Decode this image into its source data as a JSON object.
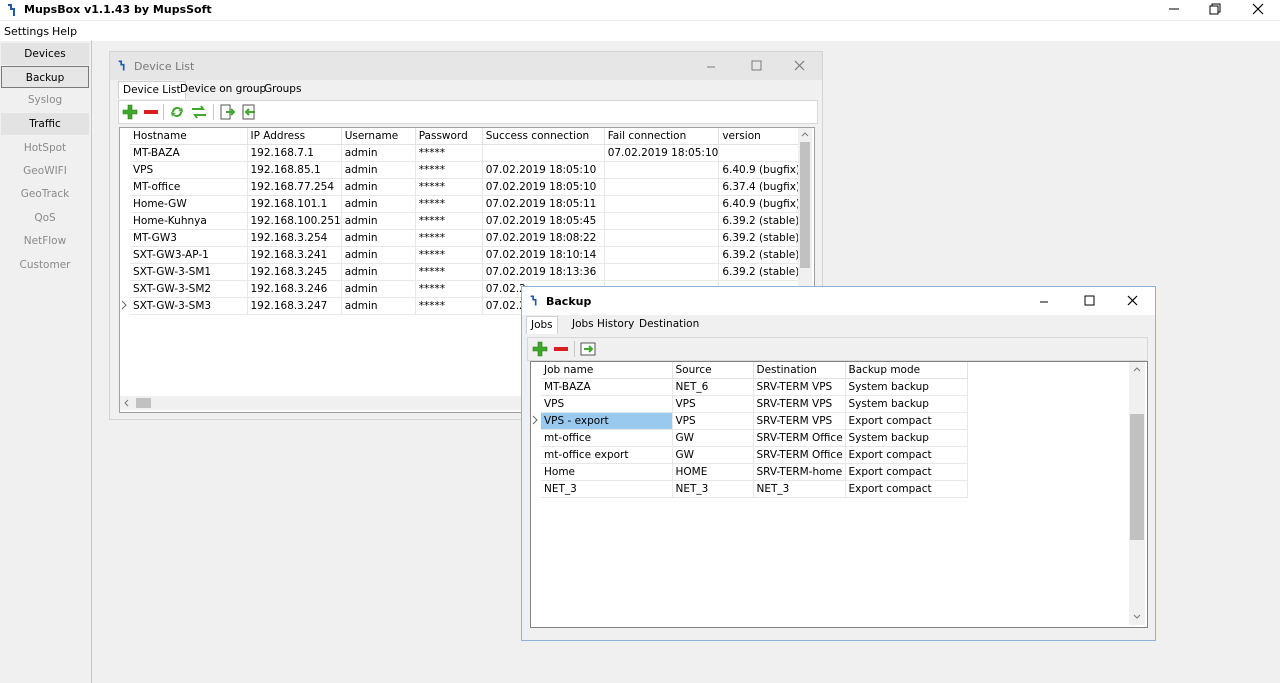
{
  "app": {
    "title": "MupsBox v1.1.43  by MupsSoft",
    "menu": [
      "Settings",
      "Help"
    ]
  },
  "nav": [
    {
      "label": "Devices",
      "state": "enabled"
    },
    {
      "label": "Backup",
      "state": "selected"
    },
    {
      "label": "Syslog",
      "state": "disabled"
    },
    {
      "label": "Traffic",
      "state": "enabled"
    },
    {
      "label": "HotSpot",
      "state": "disabled"
    },
    {
      "label": "GeoWIFI",
      "state": "disabled"
    },
    {
      "label": "GeoTrack",
      "state": "disabled"
    },
    {
      "label": "QoS",
      "state": "disabled"
    },
    {
      "label": "NetFlow",
      "state": "disabled"
    },
    {
      "label": "Customer",
      "state": "disabled"
    }
  ],
  "device_list": {
    "title": "Device List",
    "tabs": [
      "Device List",
      "Device on group",
      "Groups"
    ],
    "columns": [
      "Hostname",
      "IP Address",
      "Username",
      "Password",
      "Success connection",
      "Fail connection",
      "version"
    ],
    "rows": [
      [
        "MT-BAZA",
        "192.168.7.1",
        "admin",
        "*****",
        "",
        "07.02.2019 18:05:10",
        ""
      ],
      [
        "VPS",
        "192.168.85.1",
        "admin",
        "*****",
        "07.02.2019 18:05:10",
        "",
        "6.40.9 (bugfix)"
      ],
      [
        "MT-office",
        "192.168.77.254",
        "admin",
        "*****",
        "07.02.2019 18:05:10",
        "",
        "6.37.4 (bugfix)"
      ],
      [
        "Home-GW",
        "192.168.101.1",
        "admin",
        "*****",
        "07.02.2019 18:05:11",
        "",
        "6.40.9 (bugfix)"
      ],
      [
        "Home-Kuhnya",
        "192.168.100.251",
        "admin",
        "*****",
        "07.02.2019 18:05:45",
        "",
        "6.39.2 (stable)"
      ],
      [
        "MT-GW3",
        "192.168.3.254",
        "admin",
        "*****",
        "07.02.2019 18:08:22",
        "",
        "6.39.2 (stable)"
      ],
      [
        "SXT-GW3-AP-1",
        "192.168.3.241",
        "admin",
        "*****",
        "07.02.2019 18:10:14",
        "",
        "6.39.2 (stable)"
      ],
      [
        "SXT-GW-3-SM1",
        "192.168.3.245",
        "admin",
        "*****",
        "07.02.2019 18:13:36",
        "",
        "6.39.2 (stable)"
      ],
      [
        "SXT-GW-3-SM2",
        "192.168.3.246",
        "admin",
        "*****",
        "07.02.2",
        "",
        ""
      ],
      [
        "SXT-GW-3-SM3",
        "192.168.3.247",
        "admin",
        "*****",
        "07.02.2",
        "",
        ""
      ]
    ],
    "current_row": 9
  },
  "backup": {
    "title": "Backup",
    "tabs": [
      "Jobs",
      "Jobs History",
      "Destination"
    ],
    "columns": [
      "Job name",
      "Source",
      "Destination",
      "Backup mode"
    ],
    "rows": [
      [
        "MT-BAZA",
        "NET_6",
        "SRV-TERM VPS",
        "System backup"
      ],
      [
        "VPS",
        "VPS",
        "SRV-TERM VPS",
        "System backup"
      ],
      [
        "VPS - export",
        "VPS",
        "SRV-TERM VPS",
        "Export compact"
      ],
      [
        "mt-office",
        "GW",
        "SRV-TERM Office",
        "System backup"
      ],
      [
        "mt-office export",
        "GW",
        "SRV-TERM Office",
        "Export compact"
      ],
      [
        "Home",
        "HOME",
        "SRV-TERM-home",
        "Export compact"
      ],
      [
        "NET_3",
        "NET_3",
        "NET_3",
        "Export compact"
      ]
    ],
    "current_row": 2
  },
  "colors": {
    "selection": "#99c9ef",
    "add_icon": "#3fa82c",
    "remove_icon": "#d81e1e"
  }
}
